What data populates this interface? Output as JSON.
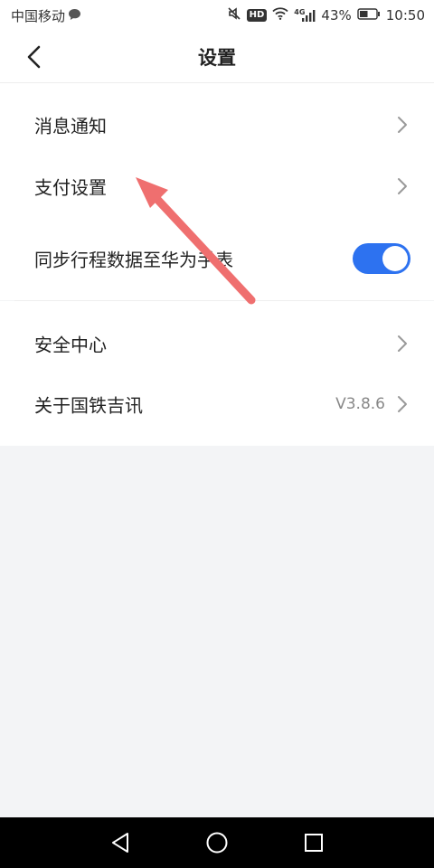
{
  "status_bar": {
    "carrier": "中国移动",
    "hd": "HD",
    "network": "4G",
    "battery": "43%",
    "time": "10:50"
  },
  "header": {
    "title": "设置"
  },
  "settings": {
    "notifications": "消息通知",
    "payment": "支付设置",
    "sync_watch": "同步行程数据至华为手表",
    "sync_watch_on": true,
    "security": "安全中心",
    "about": "关于国铁吉讯",
    "version": "V3.8.6"
  },
  "colors": {
    "accent": "#2d72f0",
    "annotation": "#ef6f6f"
  },
  "icons": {
    "back": "back-chevron-icon",
    "chevron": "chevron-right-icon",
    "nav_back": "triangle-back-icon",
    "nav_home": "circle-home-icon",
    "nav_recent": "square-recent-icon"
  }
}
